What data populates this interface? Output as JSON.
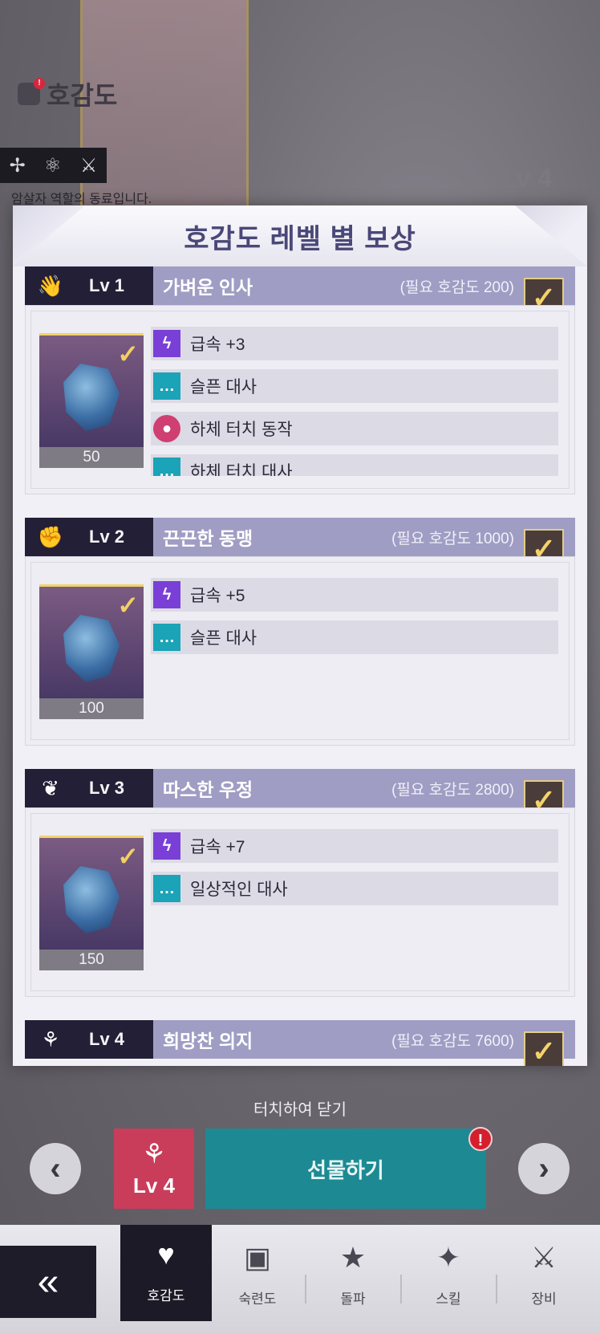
{
  "background": {
    "title": "호감도",
    "title_badge": "!",
    "role_text": "암살자 역할의 동료입니다.",
    "level": "Lv 4",
    "role_icons": [
      "pinwheel-icon",
      "atom-icon",
      "swords-icon"
    ]
  },
  "modal": {
    "title": "호감도 레벨 별 보상",
    "levels": [
      {
        "icon": "wave-hands-icon",
        "lv": "Lv 1",
        "name": "가벼운 인사",
        "requirement": "(필요 호감도 200)",
        "claimed": true,
        "gem_count": "50",
        "rewards": [
          {
            "icon": "bolt",
            "text": "급속 +3"
          },
          {
            "icon": "chat",
            "text": "슬픈 대사"
          },
          {
            "icon": "person",
            "text": "하체 터치 동작"
          },
          {
            "icon": "chat",
            "text": "하체 터치 대사"
          }
        ]
      },
      {
        "icon": "fist-bump-icon",
        "lv": "Lv 2",
        "name": "끈끈한 동맹",
        "requirement": "(필요 호감도 1000)",
        "claimed": true,
        "gem_count": "100",
        "rewards": [
          {
            "icon": "bolt",
            "text": "급속 +5"
          },
          {
            "icon": "chat",
            "text": "슬픈 대사"
          }
        ]
      },
      {
        "icon": "friends-icon",
        "lv": "Lv 3",
        "name": "따스한 우정",
        "requirement": "(필요 호감도 2800)",
        "claimed": true,
        "gem_count": "150",
        "rewards": [
          {
            "icon": "bolt",
            "text": "급속 +7"
          },
          {
            "icon": "chat",
            "text": "일상적인 대사"
          }
        ]
      },
      {
        "icon": "cheer-icon",
        "lv": "Lv 4",
        "name": "희망찬 의지",
        "requirement": "(필요 호감도 7600)",
        "claimed": true
      }
    ]
  },
  "tap_to_close": "터치하여 닫기",
  "gift": {
    "level_tile": "Lv 4",
    "button_label": "선물하기",
    "alert": "!"
  },
  "tabs": [
    {
      "label": "호감도",
      "icon": "heart-plus-icon",
      "active": true
    },
    {
      "label": "숙련도",
      "icon": "book-icon",
      "active": false
    },
    {
      "label": "돌파",
      "icon": "star-icon",
      "active": false
    },
    {
      "label": "스킬",
      "icon": "skill-icon",
      "active": false
    },
    {
      "label": "장비",
      "icon": "sword-shield-icon",
      "active": false
    }
  ]
}
